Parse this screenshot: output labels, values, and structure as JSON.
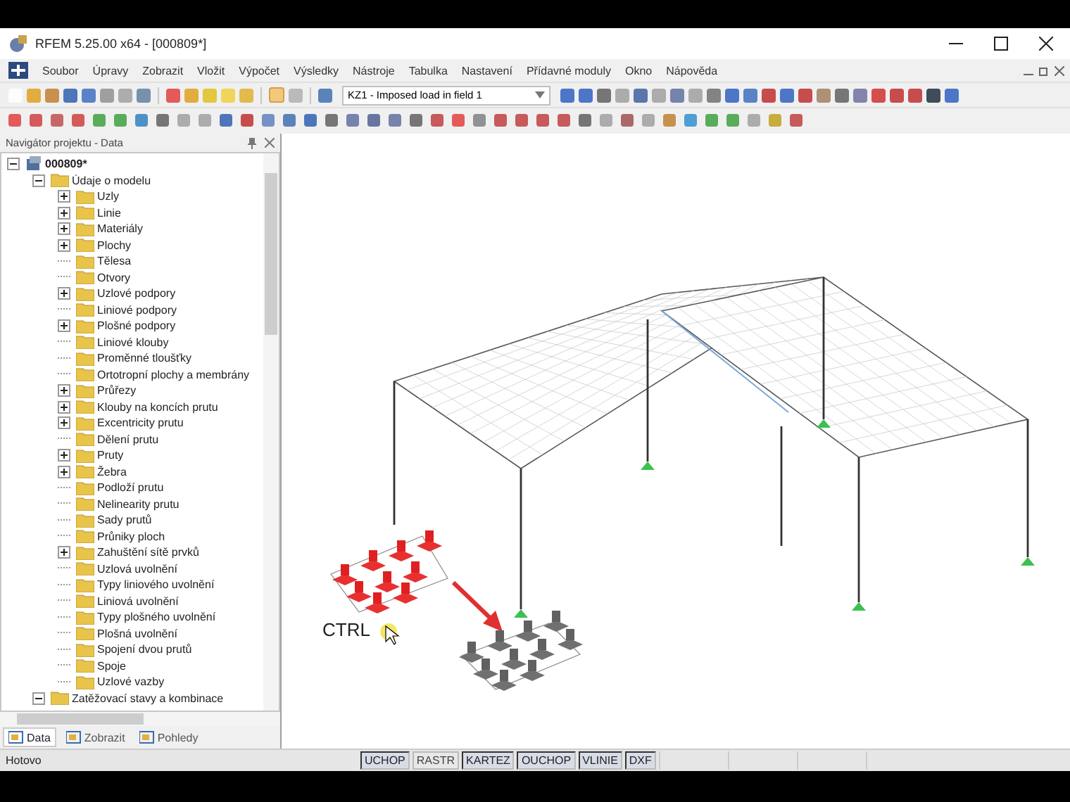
{
  "window": {
    "title": "RFEM 5.25.00 x64 - [000809*]"
  },
  "menu": [
    "Soubor",
    "Úpravy",
    "Zobrazit",
    "Vložit",
    "Výpočet",
    "Výsledky",
    "Nástroje",
    "Tabulka",
    "Nastavení",
    "Přídavné moduly",
    "Okno",
    "Nápověda"
  ],
  "toolbar": {
    "load_case": "KZ1 - Imposed load in field 1"
  },
  "navigator": {
    "title": "Navigátor projektu - Data",
    "tree": [
      {
        "label": "000809*",
        "expandable": true,
        "expanded": true,
        "children": [
          {
            "label": "Údaje o modelu",
            "expandable": true,
            "expanded": true,
            "children": [
              {
                "label": "Uzly",
                "expandable": true,
                "expanded": false
              },
              {
                "label": "Linie",
                "expandable": true,
                "expanded": false
              },
              {
                "label": "Materiály",
                "expandable": true,
                "expanded": false
              },
              {
                "label": "Plochy",
                "expandable": true,
                "expanded": false
              },
              {
                "label": "Tělesa",
                "expandable": false,
                "expanded": false
              },
              {
                "label": "Otvory",
                "expandable": false,
                "expanded": false
              },
              {
                "label": "Uzlové podpory",
                "expandable": true,
                "expanded": false
              },
              {
                "label": "Liniové podpory",
                "expandable": false,
                "expanded": false
              },
              {
                "label": "Plošné podpory",
                "expandable": true,
                "expanded": false
              },
              {
                "label": "Liniové klouby",
                "expandable": false,
                "expanded": false
              },
              {
                "label": "Proměnné tloušťky",
                "expandable": false,
                "expanded": false
              },
              {
                "label": "Ortotropní plochy a membrány",
                "expandable": false,
                "expanded": false
              },
              {
                "label": "Průřezy",
                "expandable": true,
                "expanded": false
              },
              {
                "label": "Klouby na koncích prutu",
                "expandable": true,
                "expanded": false
              },
              {
                "label": "Excentricity prutu",
                "expandable": true,
                "expanded": false
              },
              {
                "label": "Dělení prutu",
                "expandable": false,
                "expanded": false
              },
              {
                "label": "Pruty",
                "expandable": true,
                "expanded": false
              },
              {
                "label": "Žebra",
                "expandable": true,
                "expanded": false
              },
              {
                "label": "Podloží prutu",
                "expandable": false,
                "expanded": false
              },
              {
                "label": "Nelinearity prutu",
                "expandable": false,
                "expanded": false
              },
              {
                "label": "Sady prutů",
                "expandable": false,
                "expanded": false
              },
              {
                "label": "Průniky ploch",
                "expandable": false,
                "expanded": false
              },
              {
                "label": "Zahuštění sítě prvků",
                "expandable": true,
                "expanded": false
              },
              {
                "label": "Uzlová uvolnění",
                "expandable": false,
                "expanded": false
              },
              {
                "label": "Typy liniového uvolnění",
                "expandable": false,
                "expanded": false
              },
              {
                "label": "Liniová uvolnění",
                "expandable": false,
                "expanded": false
              },
              {
                "label": "Typy plošného uvolnění",
                "expandable": false,
                "expanded": false
              },
              {
                "label": "Plošná uvolnění",
                "expandable": false,
                "expanded": false
              },
              {
                "label": "Spojení dvou prutů",
                "expandable": false,
                "expanded": false
              },
              {
                "label": "Spoje",
                "expandable": false,
                "expanded": false
              },
              {
                "label": "Uzlové vazby",
                "expandable": false,
                "expanded": false
              }
            ]
          },
          {
            "label": "Zatěžovací stavy a kombinace",
            "expandable": true,
            "expanded": true
          }
        ]
      }
    ],
    "tabs": [
      {
        "label": "Data",
        "selected": true
      },
      {
        "label": "Zobrazit",
        "selected": false
      },
      {
        "label": "Pohledy",
        "selected": false
      }
    ]
  },
  "canvas": {
    "key_label": "CTRL"
  },
  "status_bar": {
    "text": "Hotovo",
    "toggles": [
      {
        "label": "UCHOP",
        "on": true
      },
      {
        "label": "RASTR",
        "on": false
      },
      {
        "label": "KARTEZ",
        "on": true
      },
      {
        "label": "OUCHOP",
        "on": true
      },
      {
        "label": "VLINIE",
        "on": true
      },
      {
        "label": "DXF",
        "on": true
      }
    ]
  }
}
